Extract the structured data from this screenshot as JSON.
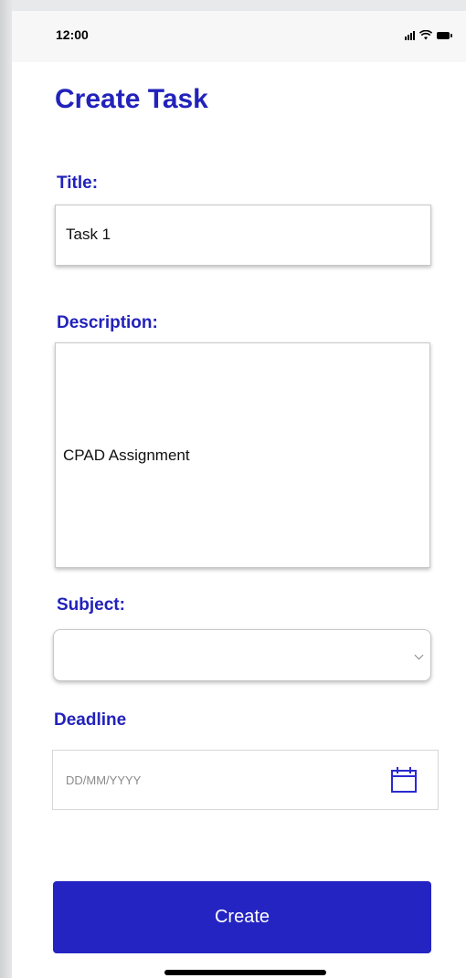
{
  "status_bar": {
    "time": "12:00",
    "icons": [
      "signal-icon",
      "wifi-icon",
      "battery-icon"
    ]
  },
  "page": {
    "title": "Create Task"
  },
  "form": {
    "title_label": "Title:",
    "title_value": "Task 1",
    "description_label": "Description:",
    "description_value": "CPAD Assignment",
    "subject_label": "Subject:",
    "subject_value": "",
    "deadline_label": "Deadline",
    "deadline_placeholder": "DD/MM/YYYY",
    "create_label": "Create"
  },
  "colors": {
    "accent": "#2222bb",
    "button": "#2424c3",
    "background": "#ffffff"
  }
}
